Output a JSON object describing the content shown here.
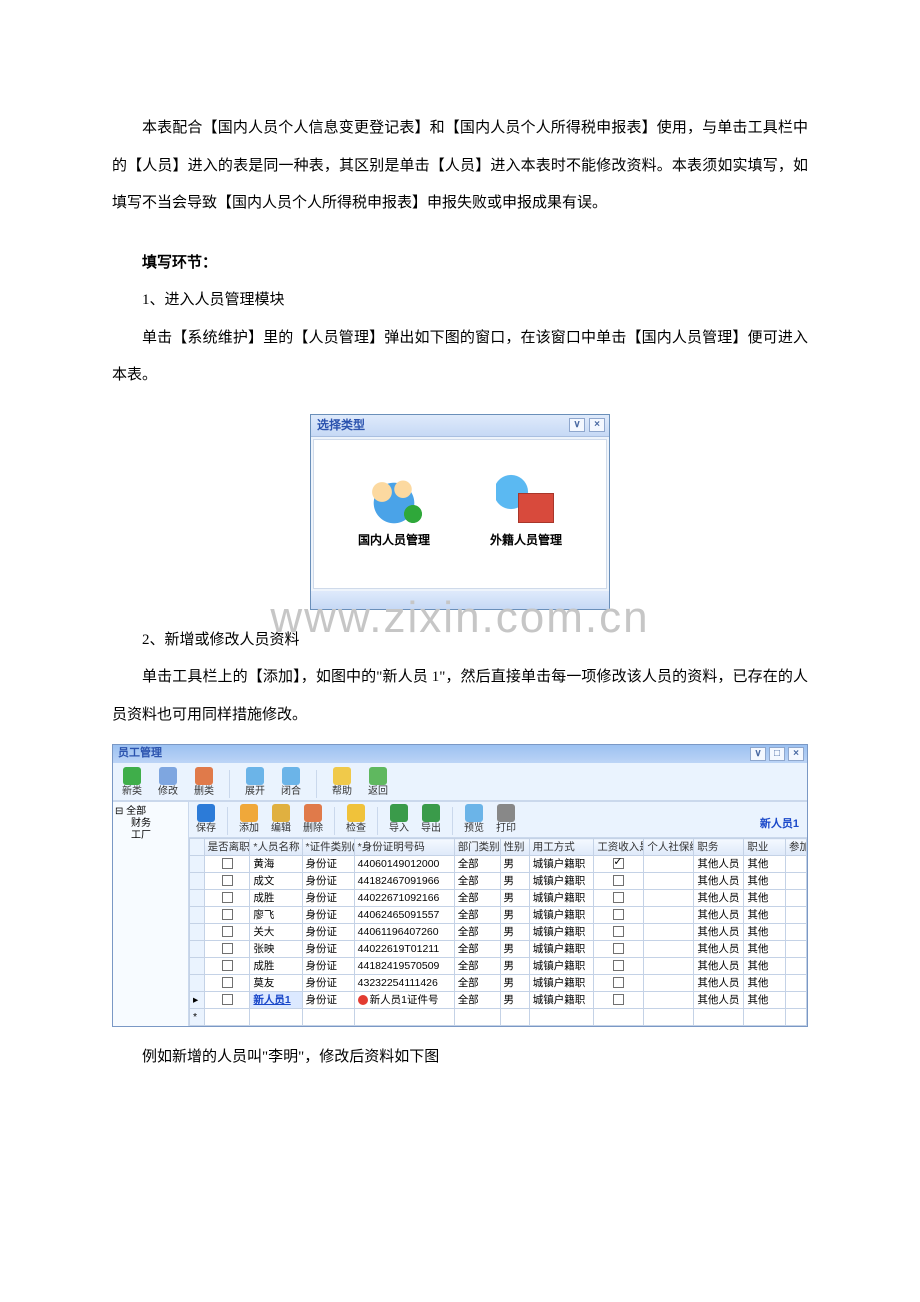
{
  "doc": {
    "p1": "本表配合【国内人员个人信息变更登记表】和【国内人员个人所得税申报表】使用，与单击工具栏中的【人员】进入的表是同一种表，其区别是单击【人员】进入本表时不能修改资料。本表须如实填写，如填写不当会导致【国内人员个人所得税申报表】申报失败或申报成果有误。",
    "h2": "填写环节：",
    "step1": "1、进入人员管理模块",
    "step1b": "单击【系统维护】里的【人员管理】弹出如下图的窗口，在该窗口中单击【国内人员管理】便可进入本表。",
    "step2": "2、新增或修改人员资料",
    "step2b": "单击工具栏上的【添加】，如图中的\"新人员 1\"，然后直接单击每一项修改该人员的资料，已存在的人员资料也可用同样措施修改。",
    "p_after": "例如新增的人员叫\"李明\"，修改后资料如下图",
    "watermark": "www.zixin.com.cn"
  },
  "dialog": {
    "title": "选择类型",
    "opt1": "国内人员管理",
    "opt2": "外籍人员管理"
  },
  "app": {
    "title": "员工管理",
    "newperson_label": "新人员1",
    "tree": {
      "root": "全部",
      "c1": "财务",
      "c2": "工厂"
    },
    "toolbar1": [
      "新类",
      "修改",
      "删类",
      "展开",
      "闭合",
      "帮助",
      "返回"
    ],
    "toolbar2": [
      "保存",
      "添加",
      "编辑",
      "删除",
      "检查",
      "导入",
      "导出",
      "预览",
      "打印"
    ],
    "columns": [
      "",
      "是否离职",
      "*人员名称",
      "*证件类别(",
      "*身份证明号码",
      "部门类别",
      "性别",
      "用工方式",
      "工资收入是",
      "个人社保编",
      "职务",
      "职业",
      "参加"
    ],
    "rows": [
      {
        "name": "黄海",
        "type": "身份证",
        "id": "44060149012000",
        "dept": "全部",
        "sex": "男",
        "emp": "城镇户籍职",
        "wage": true,
        "duty": "其他人员",
        "job": "其他"
      },
      {
        "name": "成文",
        "type": "身份证",
        "id": "44182467091966",
        "dept": "全部",
        "sex": "男",
        "emp": "城镇户籍职",
        "wage": false,
        "duty": "其他人员",
        "job": "其他"
      },
      {
        "name": "成胜",
        "type": "身份证",
        "id": "44022671092166",
        "dept": "全部",
        "sex": "男",
        "emp": "城镇户籍职",
        "wage": false,
        "duty": "其他人员",
        "job": "其他"
      },
      {
        "name": "廖飞",
        "type": "身份证",
        "id": "44062465091557",
        "dept": "全部",
        "sex": "男",
        "emp": "城镇户籍职",
        "wage": false,
        "duty": "其他人员",
        "job": "其他"
      },
      {
        "name": "关大",
        "type": "身份证",
        "id": "44061196407260",
        "dept": "全部",
        "sex": "男",
        "emp": "城镇户籍职",
        "wage": false,
        "duty": "其他人员",
        "job": "其他"
      },
      {
        "name": "张映",
        "type": "身份证",
        "id": "44022619T01211",
        "dept": "全部",
        "sex": "男",
        "emp": "城镇户籍职",
        "wage": false,
        "duty": "其他人员",
        "job": "其他"
      },
      {
        "name": "成胜",
        "type": "身份证",
        "id": "44182419570509",
        "dept": "全部",
        "sex": "男",
        "emp": "城镇户籍职",
        "wage": false,
        "duty": "其他人员",
        "job": "其他"
      },
      {
        "name": "莫友",
        "type": "身份证",
        "id": "43232254111426",
        "dept": "全部",
        "sex": "男",
        "emp": "城镇户籍职",
        "wage": false,
        "duty": "其他人员",
        "job": "其他"
      }
    ],
    "editing_row": {
      "name": "新人员1",
      "type": "身份证",
      "id_prefix": "新人员1证件号",
      "dept": "全部",
      "sex": "男",
      "emp": "城镇户籍职",
      "wage": false,
      "duty": "其他人员",
      "job": "其他"
    }
  }
}
